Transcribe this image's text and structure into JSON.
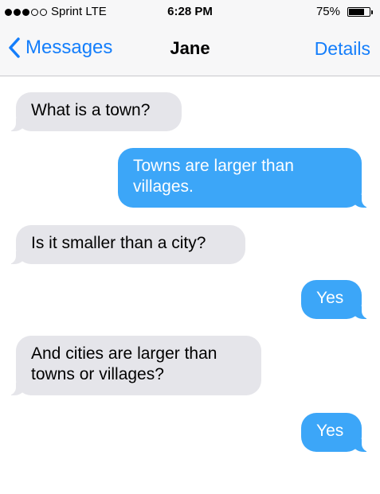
{
  "status_bar": {
    "carrier": "Sprint  LTE",
    "time": "6:28 PM",
    "battery_percent": "75%",
    "battery_level": 0.75,
    "signal_bars_filled": 3,
    "signal_bars_total": 5
  },
  "nav": {
    "back_label": "Messages",
    "title": "Jane",
    "details_label": "Details"
  },
  "colors": {
    "accent": "#147efb",
    "outgoing_bubble": "#3ca6f8",
    "incoming_bubble": "#e5e5ea"
  },
  "messages": [
    {
      "direction": "incoming",
      "text": "What is a town?"
    },
    {
      "direction": "outgoing",
      "text": "Towns are larger than villages."
    },
    {
      "direction": "incoming",
      "text": "Is it smaller than a city?"
    },
    {
      "direction": "outgoing",
      "text": "Yes"
    },
    {
      "direction": "incoming",
      "text": "And cities are larger than towns or villages?"
    },
    {
      "direction": "outgoing",
      "text": "Yes"
    }
  ]
}
